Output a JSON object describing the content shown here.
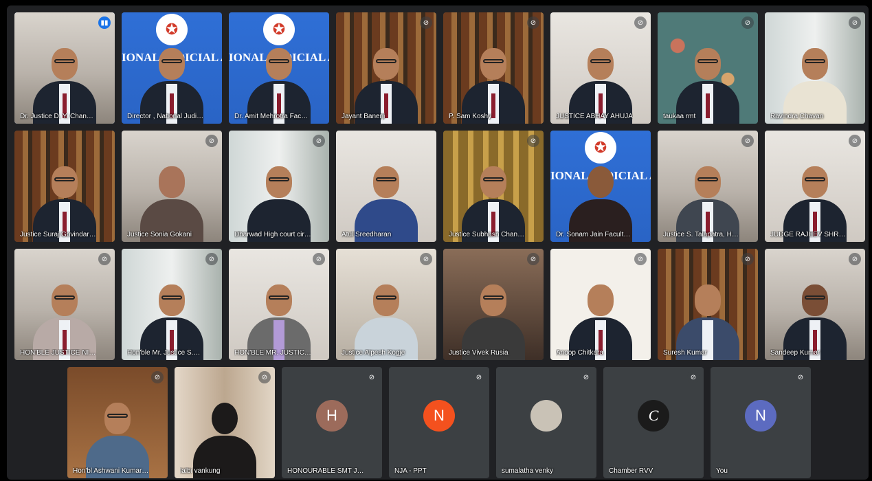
{
  "participants": [
    {
      "name": "Dr. Justice D. Y. Chandrach...",
      "mic": "speaking"
    },
    {
      "name": "Director , National Judicial ...",
      "mic": "none",
      "banner": "IONAL JUDICIAL ACADI"
    },
    {
      "name": "Dr. Amit Mehrotra Faculty, ...",
      "mic": "none",
      "banner": "IONAL JUDICIAL ACADI"
    },
    {
      "name": "Jayant Banerji",
      "mic": "muted"
    },
    {
      "name": "P. Sam Koshy",
      "mic": "muted"
    },
    {
      "name": "JUSTICE ABHAY AHUJA",
      "mic": "muted"
    },
    {
      "name": "taukaa rmt",
      "mic": "muted"
    },
    {
      "name": "Ravindra Chavan",
      "mic": "muted"
    },
    {
      "name": "Justice Suraj Govindaraj - ...",
      "mic": "muted"
    },
    {
      "name": "Justice Sonia Gokani",
      "mic": "muted"
    },
    {
      "name": "Dharwad High court circuit...",
      "mic": "muted"
    },
    {
      "name": "Atul Sreedharan",
      "mic": "muted"
    },
    {
      "name": "Justice Subhash Chand Jha...",
      "mic": "muted"
    },
    {
      "name": "Dr. Sonam Jain Faculty NJA",
      "mic": "none",
      "banner": "IONAL JUDICIAL ACADI"
    },
    {
      "name": "Justice S. Talapatra, High C...",
      "mic": "muted"
    },
    {
      "name": "JUDGE RAJEEV SHRIVASTA...",
      "mic": "muted"
    },
    {
      "name": "HON'BLE JUSTICE NITIN B S...",
      "mic": "muted"
    },
    {
      "name": "Hon'ble Mr. Justice S.G. Ch...",
      "mic": "muted"
    },
    {
      "name": "HON'BLE MR. JUSTICE AMB...",
      "mic": "muted"
    },
    {
      "name": "Justice Alpesh Kogje",
      "mic": "muted"
    },
    {
      "name": "Justice Vivek Rusia",
      "mic": "muted"
    },
    {
      "name": "Anoop Chitkara",
      "mic": "muted"
    },
    {
      "name": "Suresh Kumar",
      "mic": "muted"
    },
    {
      "name": "Sandeep Kumar",
      "mic": "muted"
    },
    {
      "name": "Hon'bl Ashwani Kumar Mis...",
      "mic": "muted"
    },
    {
      "name": "lalbi vankung",
      "mic": "muted"
    },
    {
      "name": "HONOURABLE SMT JUSTICE ...",
      "mic": "muted",
      "initial": "H",
      "avatar_color": "#9c6b5b"
    },
    {
      "name": "NJA - PPT",
      "mic": "muted",
      "initial": "N",
      "avatar_color": "#f4511e"
    },
    {
      "name": "sumalatha venky",
      "mic": "muted",
      "initial": "",
      "avatar_color": "#c9c2b6"
    },
    {
      "name": "Chamber RVV",
      "mic": "muted",
      "initial": "C",
      "avatar_color": "#1b1b1b"
    },
    {
      "name": "You",
      "mic": "muted",
      "initial": "N",
      "avatar_color": "#5c6bc0"
    }
  ],
  "icons": {
    "mic_muted": "mic-off-icon",
    "mic_speaking": "audio-level-icon",
    "logo": "academy-logo-icon"
  }
}
